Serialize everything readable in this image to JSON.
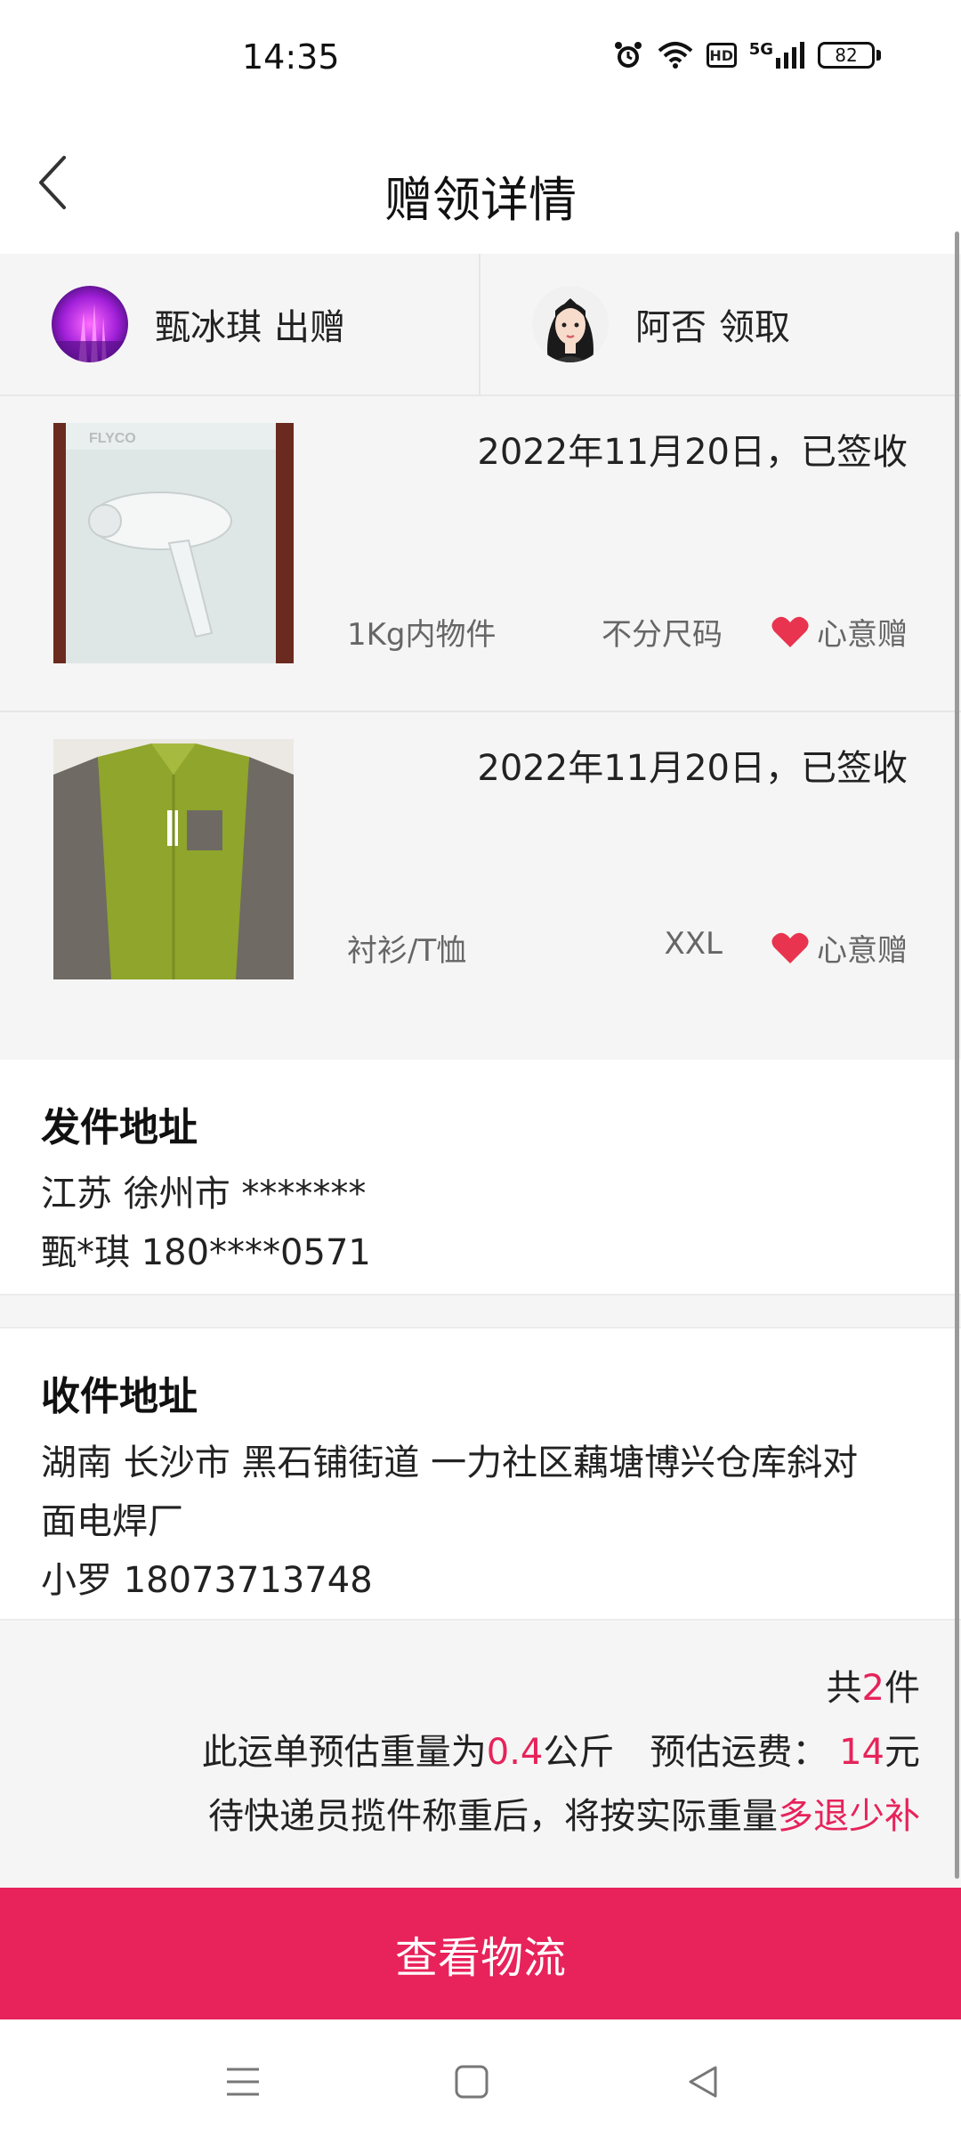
{
  "status_bar": {
    "time": "14:35",
    "battery": "82",
    "network": "5G",
    "hd_badge": "HD",
    "icons": [
      "alarm-icon",
      "wifi-icon",
      "hd-icon",
      "signal-5g-icon",
      "battery-icon"
    ]
  },
  "header": {
    "title": "赠领详情",
    "back_icon": "chevron-left-icon"
  },
  "users": {
    "giver": {
      "name": "甄冰琪",
      "action": "出赠"
    },
    "receiver": {
      "name": "阿否",
      "action": "领取"
    }
  },
  "items": [
    {
      "date": "2022年11月20日，已签收",
      "category": "1Kg内物件",
      "size": "不分尺码",
      "tag": "心意赠",
      "image": "hair-dryer-box"
    },
    {
      "date": "2022年11月20日，已签收",
      "category": "衬衫/T恤",
      "size": "XXL",
      "tag": "心意赠",
      "image": "green-jacket"
    }
  ],
  "sender_address": {
    "title": "发件地址",
    "line1": "江苏 徐州市 *******",
    "line2": "甄*琪 180****0571"
  },
  "receiver_address": {
    "title": "收件地址",
    "line1": "湖南 长沙市 黑石铺街道 一力社区藕塘博兴仓库斜对",
    "line2": "面电焊厂",
    "line3": "小罗 18073713748"
  },
  "summary": {
    "count_prefix": "共",
    "count": "2",
    "count_suffix": "件",
    "weight_prefix": "此运单预估重量为",
    "weight": "0.4",
    "weight_unit": "公斤",
    "fee_prefix": "预估运费：",
    "fee": "14",
    "fee_unit": "元",
    "note_prefix": "待快递员揽件称重后，将按实际重量",
    "note_accent": "多退少补"
  },
  "colors": {
    "accent": "#e8225a",
    "background": "#f5f5f5"
  },
  "actions": {
    "view_logistics": "查看物流"
  },
  "nav_bar": {
    "icons": [
      "menu-icon",
      "home-square-icon",
      "back-triangle-icon"
    ]
  }
}
